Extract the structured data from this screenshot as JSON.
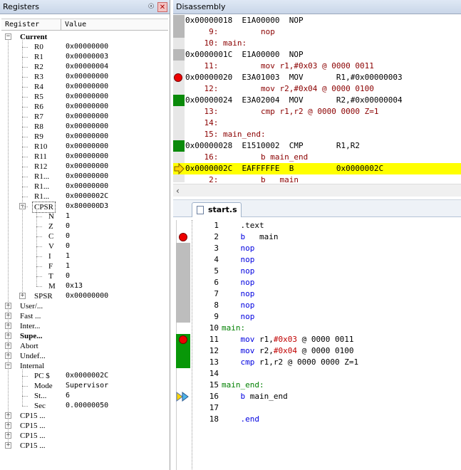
{
  "registers": {
    "title": "Registers",
    "pin_icon": "pin-icon",
    "close_icon": "close-icon",
    "col_register": "Register",
    "col_value": "Value",
    "current_label": "Current",
    "regs": [
      {
        "name": "R0",
        "value": "0x00000000"
      },
      {
        "name": "R1",
        "value": "0x00000003"
      },
      {
        "name": "R2",
        "value": "0x00000004"
      },
      {
        "name": "R3",
        "value": "0x00000000"
      },
      {
        "name": "R4",
        "value": "0x00000000"
      },
      {
        "name": "R5",
        "value": "0x00000000"
      },
      {
        "name": "R6",
        "value": "0x00000000"
      },
      {
        "name": "R7",
        "value": "0x00000000"
      },
      {
        "name": "R8",
        "value": "0x00000000"
      },
      {
        "name": "R9",
        "value": "0x00000000"
      },
      {
        "name": "R10",
        "value": "0x00000000"
      },
      {
        "name": "R11",
        "value": "0x00000000"
      },
      {
        "name": "R12",
        "value": "0x00000000"
      },
      {
        "name": "R1...",
        "value": "0x00000000"
      },
      {
        "name": "R1...",
        "value": "0x00000000"
      },
      {
        "name": "R1...",
        "value": "0x0000002C"
      }
    ],
    "cpsr": {
      "name": "CPSR",
      "value": "0x800000D3"
    },
    "flags": [
      {
        "name": "N",
        "value": "1"
      },
      {
        "name": "Z",
        "value": "0"
      },
      {
        "name": "C",
        "value": "0"
      },
      {
        "name": "V",
        "value": "0"
      },
      {
        "name": "I",
        "value": "1"
      },
      {
        "name": "F",
        "value": "1"
      },
      {
        "name": "T",
        "value": "0"
      },
      {
        "name": "M",
        "value": "0x13"
      }
    ],
    "spsr": {
      "name": "SPSR",
      "value": "0x00000000"
    },
    "modes": [
      "User/...",
      "Fast ...",
      "Inter...",
      "Supe...",
      "Abort",
      "Undef..."
    ],
    "internal_label": "Internal",
    "internal": [
      {
        "name": "PC  $",
        "value": "0x0000002C"
      },
      {
        "name": "Mode",
        "value": "Supervisor"
      },
      {
        "name": "St...",
        "value": "6"
      },
      {
        "name": "Sec",
        "value": "0.00000050"
      }
    ],
    "cp15": [
      "CP15 ...",
      "CP15 ...",
      "CP15 ...",
      "CP15 ..."
    ]
  },
  "disassembly": {
    "title": "Disassembly",
    "scroll_left_icon": "chevron-left-icon",
    "lines": [
      {
        "kind": "asm",
        "text": "0x00000018  E1A00000  NOP",
        "mark": "gray"
      },
      {
        "kind": "src",
        "text": "     9:         nop",
        "mark": "gray"
      },
      {
        "kind": "src",
        "text": "    10: main:",
        "mark": ""
      },
      {
        "kind": "asm",
        "text": "0x0000001C  E1A00000  NOP",
        "mark": "gray"
      },
      {
        "kind": "src",
        "text": "    11:         mov r1,#0x03 @ 0000 0011",
        "mark": ""
      },
      {
        "kind": "asm",
        "text": "0x00000020  E3A01003  MOV       R1,#0x00000003",
        "mark": "breakpoint"
      },
      {
        "kind": "src",
        "text": "    12:         mov r2,#0x04 @ 0000 0100",
        "mark": ""
      },
      {
        "kind": "asm",
        "text": "0x00000024  E3A02004  MOV       R2,#0x00000004",
        "mark": "green"
      },
      {
        "kind": "src",
        "text": "    13:         cmp r1,r2 @ 0000 0000 Z=1",
        "mark": ""
      },
      {
        "kind": "src",
        "text": "    14:",
        "mark": ""
      },
      {
        "kind": "src",
        "text": "    15: main_end:",
        "mark": ""
      },
      {
        "kind": "asm",
        "text": "0x00000028  E1510002  CMP       R1,R2",
        "mark": "green"
      },
      {
        "kind": "src",
        "text": "    16:         b main_end",
        "mark": ""
      },
      {
        "kind": "asm",
        "text": "0x0000002C  EAFFFFFE  B         0x0000002C",
        "mark": "current"
      },
      {
        "kind": "src",
        "text": "     2:         b   main",
        "mark": ""
      }
    ]
  },
  "editor": {
    "tab_label": "start.s",
    "lines": [
      {
        "n": "1",
        "mark": "",
        "parts": [
          {
            "t": "    .text",
            "c": "reg"
          }
        ]
      },
      {
        "n": "2",
        "mark": "breakpoint",
        "parts": [
          {
            "t": "    b",
            "c": "kw"
          },
          {
            "t": "   main",
            "c": "reg"
          }
        ]
      },
      {
        "n": "3",
        "mark": "gray",
        "parts": [
          {
            "t": "    nop",
            "c": "kw"
          }
        ]
      },
      {
        "n": "4",
        "mark": "gray",
        "parts": [
          {
            "t": "    nop",
            "c": "kw"
          }
        ]
      },
      {
        "n": "5",
        "mark": "gray",
        "parts": [
          {
            "t": "    nop",
            "c": "kw"
          }
        ]
      },
      {
        "n": "6",
        "mark": "gray",
        "parts": [
          {
            "t": "    nop",
            "c": "kw"
          }
        ]
      },
      {
        "n": "7",
        "mark": "gray",
        "parts": [
          {
            "t": "    nop",
            "c": "kw"
          }
        ]
      },
      {
        "n": "8",
        "mark": "gray",
        "parts": [
          {
            "t": "    nop",
            "c": "kw"
          }
        ]
      },
      {
        "n": "9",
        "mark": "gray",
        "parts": [
          {
            "t": "    nop",
            "c": "kw"
          }
        ]
      },
      {
        "n": "10",
        "mark": "",
        "parts": [
          {
            "t": "main:",
            "c": "lbl"
          }
        ]
      },
      {
        "n": "11",
        "mark": "breakpoint-green",
        "parts": [
          {
            "t": "    mov",
            "c": "kw"
          },
          {
            "t": " r1,",
            "c": "reg"
          },
          {
            "t": "#0x03",
            "c": "num"
          },
          {
            "t": " @ 0000 0011",
            "c": "cmt"
          }
        ]
      },
      {
        "n": "12",
        "mark": "green",
        "parts": [
          {
            "t": "    mov",
            "c": "kw"
          },
          {
            "t": " r2,",
            "c": "reg"
          },
          {
            "t": "#0x04",
            "c": "num"
          },
          {
            "t": " @ 0000 0100",
            "c": "cmt"
          }
        ]
      },
      {
        "n": "13",
        "mark": "green",
        "parts": [
          {
            "t": "    cmp",
            "c": "kw"
          },
          {
            "t": " r1,r2",
            "c": "reg"
          },
          {
            "t": " @ 0000 0000 Z=1",
            "c": "cmt"
          }
        ]
      },
      {
        "n": "14",
        "mark": "",
        "parts": [
          {
            "t": "",
            "c": "reg"
          }
        ]
      },
      {
        "n": "15",
        "mark": "",
        "parts": [
          {
            "t": "main_end:",
            "c": "lbl"
          }
        ]
      },
      {
        "n": "16",
        "mark": "current",
        "parts": [
          {
            "t": "    b",
            "c": "kw"
          },
          {
            "t": " main_end",
            "c": "reg"
          }
        ]
      },
      {
        "n": "17",
        "mark": "",
        "parts": [
          {
            "t": "",
            "c": "reg"
          }
        ]
      },
      {
        "n": "18",
        "mark": "",
        "parts": [
          {
            "t": "    .end",
            "c": "kw"
          }
        ]
      }
    ]
  }
}
